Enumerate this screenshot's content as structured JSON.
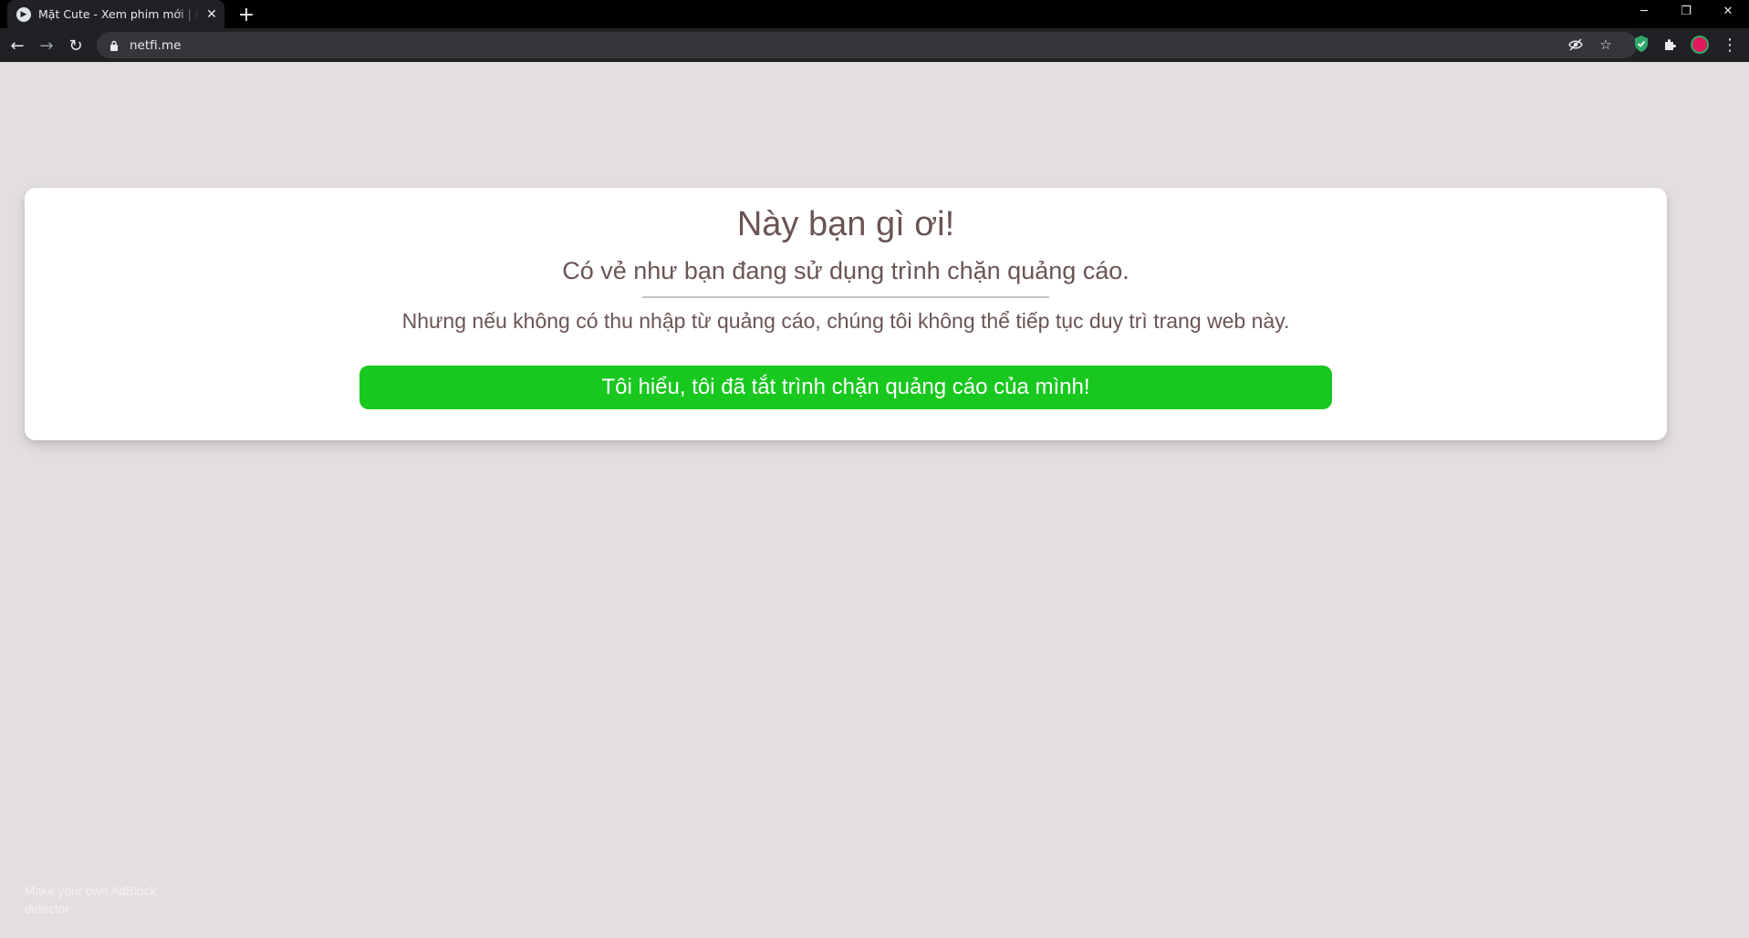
{
  "browser": {
    "tab": {
      "title": "Mặt Cute - Xem phim mới | Phim",
      "favicon": "play-circle-icon",
      "close_glyph": "✕"
    },
    "new_tab_glyph": "+",
    "window_controls": {
      "minimize": "─",
      "restore": "❐",
      "close": "✕"
    },
    "nav": {
      "back": "←",
      "forward": "→",
      "reload": "↻"
    },
    "omnibox": {
      "lock_icon": "lock-icon",
      "url": "netfi.me"
    },
    "omnibox_icons": {
      "eye_off": "👁",
      "star": "☆"
    },
    "extensions": {
      "shield_color": "#2fa86b",
      "puzzle": "✱",
      "avatar_color": "#e2195a",
      "menu": "⋮"
    }
  },
  "modal": {
    "title": "Này bạn gì ơi!",
    "subtitle": "Có vẻ như bạn đang sử dụng trình chặn quảng cáo.",
    "body": "Nhưng nếu không có thu nhập từ quảng cáo, chúng tôi không thể tiếp tục duy trì trang web này.",
    "button_label": "Tôi hiểu, tôi đã tắt trình chặn quảng cáo của mình!",
    "button_color": "#18c81f",
    "text_color": "#6b5454"
  },
  "footer": {
    "note": "Make your own AdBlock detector"
  },
  "colors": {
    "page_background": "#e4dfdf",
    "browser_frame": "#000000",
    "toolbar": "#202124"
  }
}
